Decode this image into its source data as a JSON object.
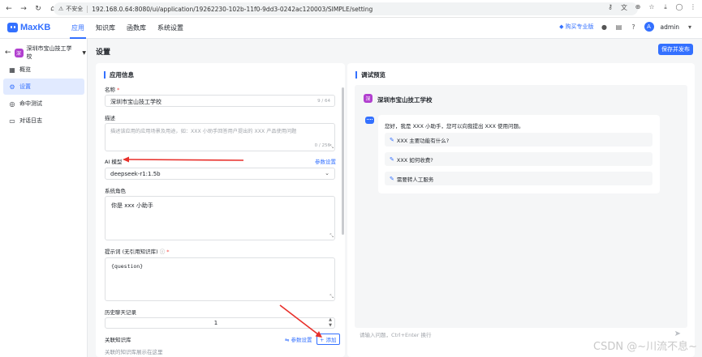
{
  "browser": {
    "insecure_label": "不安全",
    "url": "192.168.0.64:8080/ui/application/19262230-102b-11f0-9dd3-0242ac120003/SIMPLE/setting"
  },
  "header": {
    "logo_text": "MaxKB",
    "nav": [
      "应用",
      "知识库",
      "函数库",
      "系统设置"
    ],
    "pro_link": "购买专业版",
    "user": "admin",
    "avatar_letter": "A"
  },
  "sidebar": {
    "app_name": "深圳市宝山技工学校",
    "app_avatar_letter": "深",
    "items": [
      {
        "label": "概览",
        "icon": "overview-icon"
      },
      {
        "label": "设置",
        "icon": "gear-icon"
      },
      {
        "label": "命中测试",
        "icon": "target-icon"
      },
      {
        "label": "对话日志",
        "icon": "log-icon"
      }
    ]
  },
  "main": {
    "title": "设置",
    "save_button": "保存并发布"
  },
  "app_info": {
    "section_title": "应用信息",
    "name_label": "名称",
    "name_value": "深圳市宝山技工学校",
    "name_counter": "9 / 64",
    "desc_label": "描述",
    "desc_placeholder": "描述该应用的应用场景及用途，如：XXX 小助手回答用户提出的 XXX 产品使用问题",
    "desc_counter": "0 / 256",
    "model_label": "AI 模型",
    "model_params_link": "参数设置",
    "model_value": "deepseek-r1:1.5b",
    "role_label": "系统角色",
    "role_value": "你是 xxx 小助手",
    "prompt_label": "提示词 (无引用知识库)",
    "prompt_value": "{question}",
    "history_label": "历史聊天记录",
    "history_value": "1",
    "kb_label": "关联知识库",
    "kb_params_link": "参数设置",
    "kb_add_button": "+ 添加",
    "kb_hint": "关联的知识库展示在这里"
  },
  "preview": {
    "section_title": "调试预览",
    "bot_name": "深圳市宝山技工学校",
    "bot_avatar_letter": "深",
    "greeting": "您好，我是 XXX 小助手，您可以向我提出 XXX 使用问题。",
    "suggestions": [
      "XXX 主要功能有什么?",
      "XXX 如何收费?",
      "需要转人工服务"
    ],
    "input_placeholder": "请输入问题，Ctrl+Enter 换行"
  },
  "watermark": "CSDN @~川流不息~",
  "colors": {
    "accent": "#3370ff",
    "annotation_arrow": "#e8302b",
    "app_avatar": "#b13fcf"
  }
}
